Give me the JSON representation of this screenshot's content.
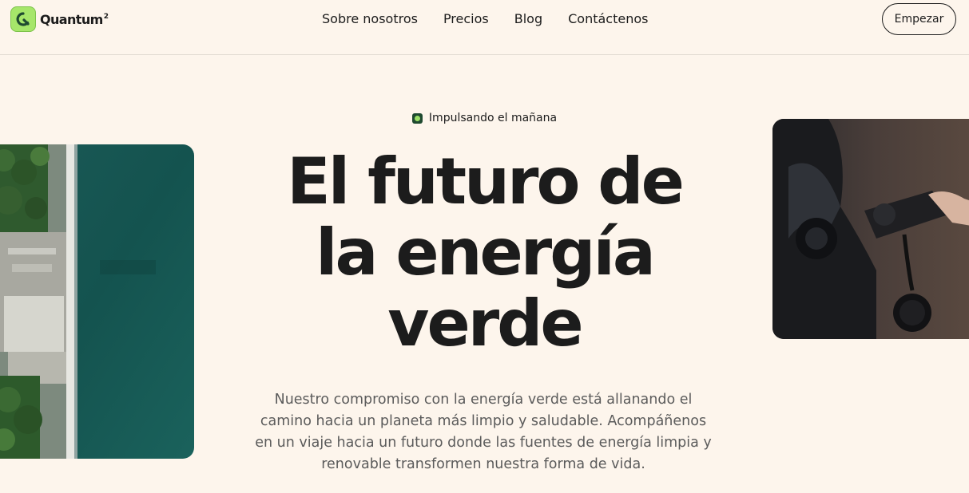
{
  "brand": {
    "name": "Quantum",
    "superscript": "2"
  },
  "nav": {
    "items": [
      {
        "label": "Sobre nosotros"
      },
      {
        "label": "Precios"
      },
      {
        "label": "Blog"
      },
      {
        "label": "Contáctenos"
      }
    ]
  },
  "header": {
    "cta_label": "Empezar"
  },
  "hero": {
    "badge": "Impulsando el mañana",
    "title_lines": [
      "El futuro de",
      "la energía",
      "verde"
    ],
    "description": "Nuestro compromiso con la energía verde está allanando el camino hacia un planeta más limpio y saludable. Acompáñenos en un viaje hacia un futuro donde las fuentes de energía limpia y renovable transformen nuestra forma de vida."
  },
  "colors": {
    "background": "#fdf5ec",
    "accent": "#a6e66a",
    "text": "#1c1c1c",
    "muted_text": "#5b5b5b"
  },
  "icons": {
    "logo": "quantum-q-icon",
    "badge": "badge-dot-icon"
  }
}
